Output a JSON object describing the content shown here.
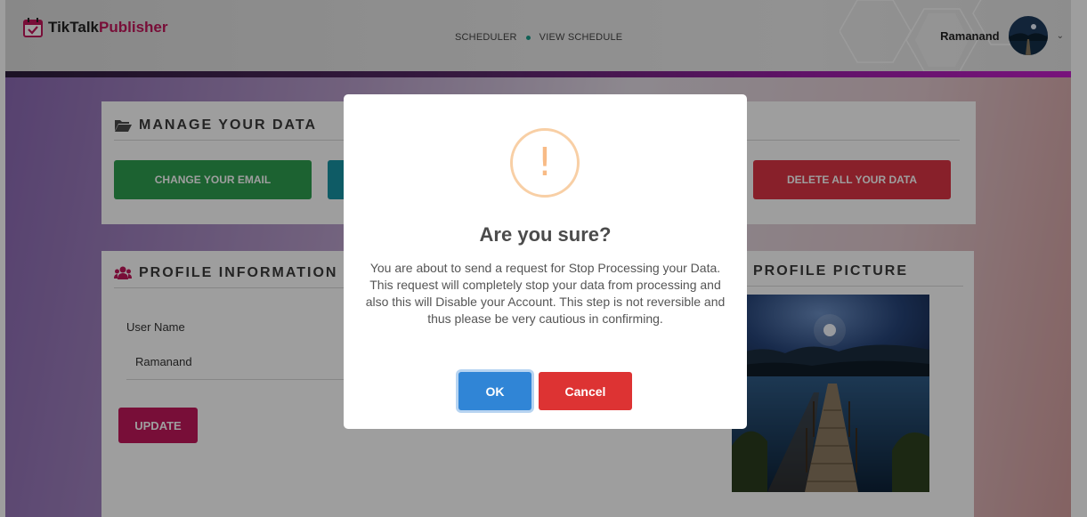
{
  "header": {
    "logo_part1": "TikTalk",
    "logo_part2": "Publisher",
    "nav": [
      "SCHEDULER",
      "VIEW SCHEDULE"
    ],
    "user_name": "Ramanand"
  },
  "manage_data": {
    "title": "MANAGE YOUR DATA",
    "buttons": {
      "change_email": "CHANGE YOUR EMAIL",
      "delete_all": "DELETE ALL YOUR DATA"
    }
  },
  "profile_info": {
    "title": "PROFILE INFORMATION",
    "user_name_label": "User Name",
    "user_name_value": "Ramanand",
    "update_label": "UPDATE"
  },
  "profile_picture": {
    "title": "PROFILE PICTURE"
  },
  "dialog": {
    "icon_glyph": "!",
    "title": "Are you sure?",
    "message": "You are about to send a request for Stop Processing your Data. This request will completely stop your data from processing and also this will Disable your Account. This step is not reversible and thus please be very cautious in confirming.",
    "ok_label": "OK",
    "cancel_label": "Cancel"
  },
  "colors": {
    "green": "#2e9e4f",
    "teal": "#1793a3",
    "red": "#dc3545",
    "magenta": "#c2185b",
    "ok": "#3085d6",
    "cancel": "#dd3333",
    "warning": "#f8bb86"
  }
}
